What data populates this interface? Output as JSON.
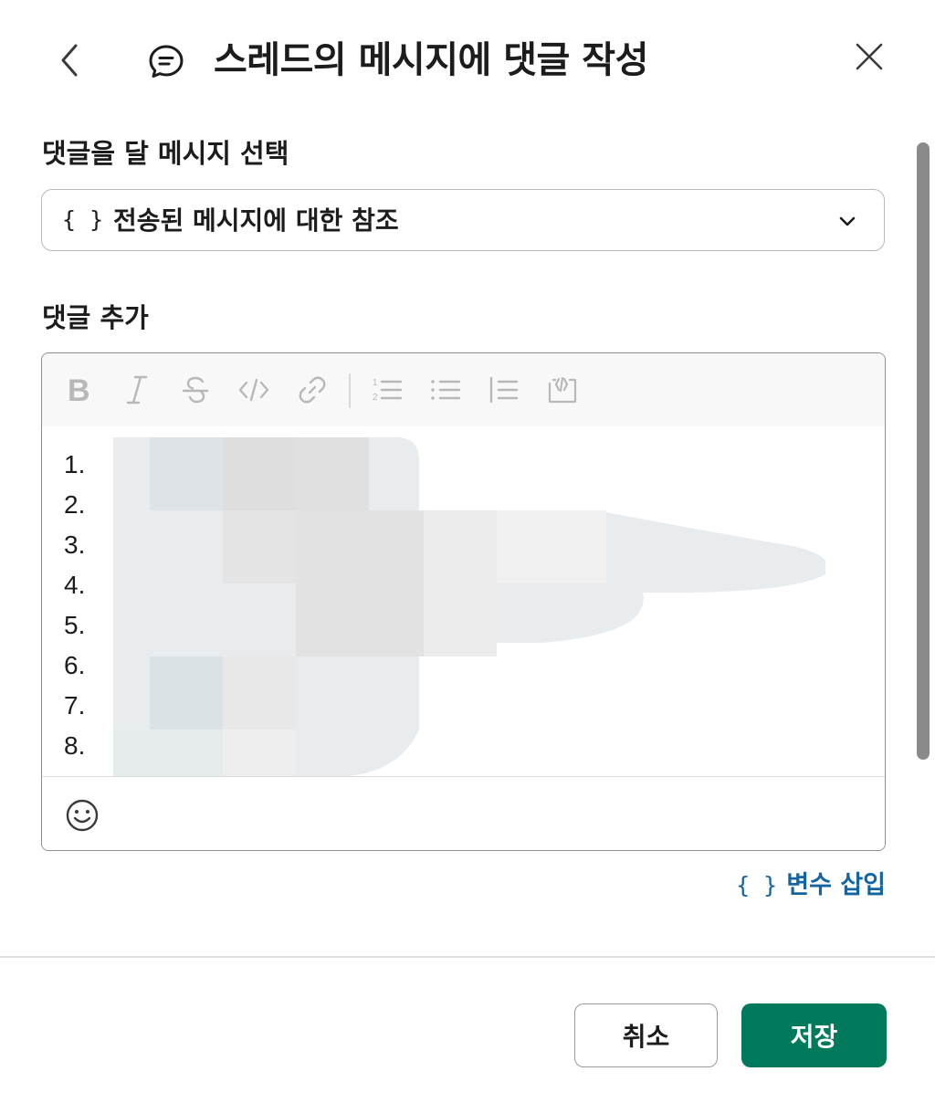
{
  "header": {
    "title": "스레드의 메시지에 댓글 작성",
    "back_icon": "chevron-left-icon",
    "title_icon": "comment-icon",
    "close_icon": "close-icon"
  },
  "select_section": {
    "label": "댓글을 달 메시지 선택",
    "value": "전송된 메시지에 대한 참조",
    "value_icon": "{ }",
    "dropdown_icon": "chevron-down-icon"
  },
  "comment_section": {
    "label": "댓글 추가",
    "toolbar": [
      "bold-icon",
      "italic-icon",
      "strikethrough-icon",
      "code-icon",
      "link-icon",
      "ordered-list-icon",
      "bulleted-list-icon",
      "blockquote-icon",
      "code-block-icon"
    ],
    "list_numbers": [
      "1.",
      "2.",
      "3.",
      "4.",
      "5.",
      "6.",
      "7.",
      "8."
    ],
    "emoji_icon": "emoji-icon"
  },
  "insert_variable": {
    "icon": "{ }",
    "label": "변수 삽입"
  },
  "footer": {
    "cancel_label": "취소",
    "save_label": "저장"
  },
  "colors": {
    "primary": "#007a5a",
    "link": "#1264a3",
    "text": "#1d1c1d",
    "toolbar_icon": "#b8b8b8"
  }
}
